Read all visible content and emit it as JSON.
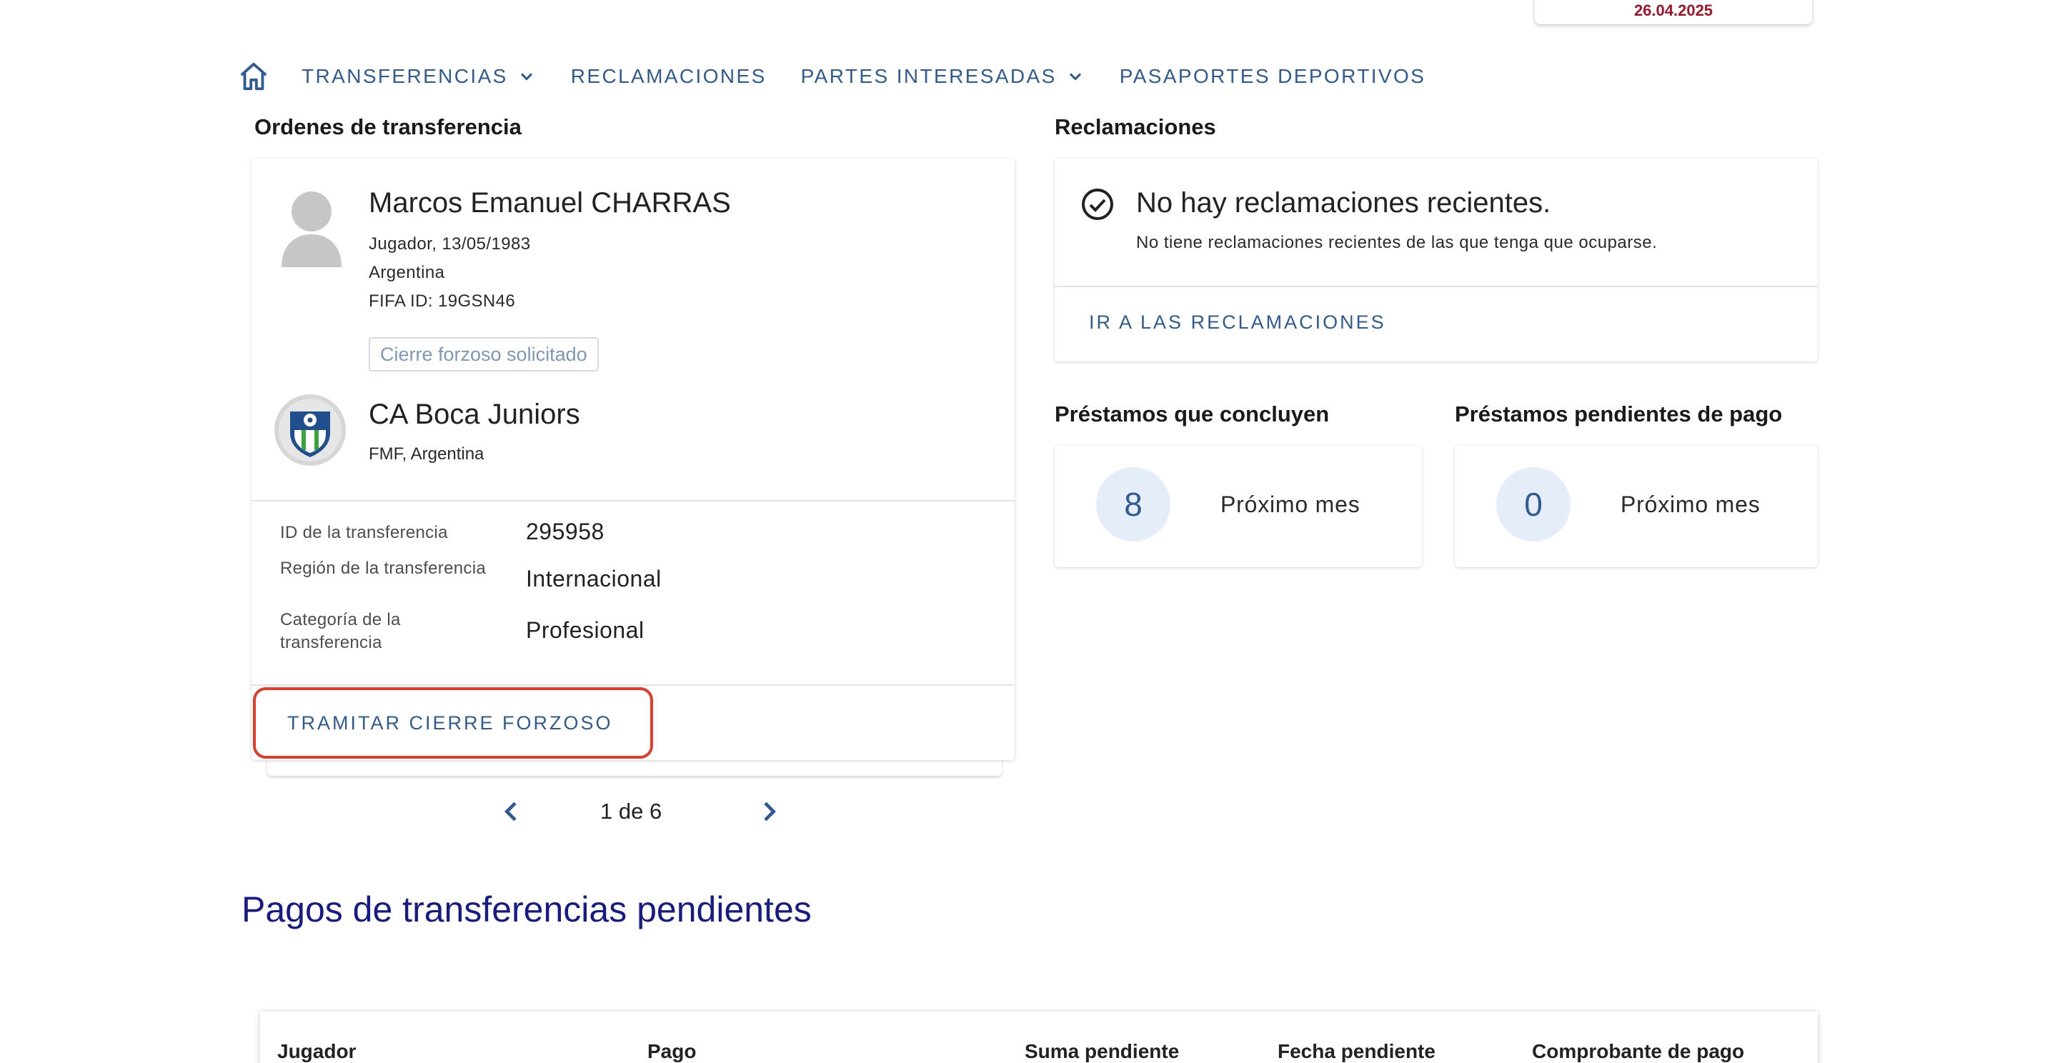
{
  "date_card": {
    "date": "26.04.2025"
  },
  "nav": {
    "items": [
      {
        "label": "TRANSFERENCIAS",
        "has_dropdown": true
      },
      {
        "label": "RECLAMACIONES",
        "has_dropdown": false
      },
      {
        "label": "PARTES INTERESADAS",
        "has_dropdown": true
      },
      {
        "label": "PASAPORTES DEPORTIVOS",
        "has_dropdown": false
      }
    ]
  },
  "transfers": {
    "section_title": "Ordenes de transferencia",
    "player": {
      "name": "Marcos Emanuel CHARRAS",
      "role_dob": "Jugador, 13/05/1983",
      "nationality": "Argentina",
      "fifa_id": "FIFA ID: 19GSN46",
      "status_badge": "Cierre forzoso solicitado"
    },
    "club": {
      "name": "CA Boca Juniors",
      "association": "FMF, Argentina"
    },
    "details": [
      {
        "label": "ID de la transferencia",
        "value": "295958"
      },
      {
        "label": "Región de la transferencia",
        "value": "Internacional"
      },
      {
        "label": "Categoría de la transferencia",
        "value": "Profesional"
      }
    ],
    "action_label": "TRAMITAR CIERRE FORZOSO",
    "pagination": {
      "text": "1 de 6",
      "current": 1,
      "total": 6
    }
  },
  "claims": {
    "section_title": "Reclamaciones",
    "title": "No hay reclamaciones recientes.",
    "subtitle": "No tiene reclamaciones recientes de las que tenga que ocuparse.",
    "link_label": "IR A LAS RECLAMACIONES"
  },
  "loans_ending": {
    "section_title": "Préstamos que concluyen",
    "count": "8",
    "period": "Próximo mes"
  },
  "loans_pending_payment": {
    "section_title": "Préstamos pendientes de pago",
    "count": "0",
    "period": "Próximo mes"
  },
  "pending_payments": {
    "title": "Pagos de transferencias pendientes",
    "columns": [
      "Jugador",
      "Pago",
      "Suma pendiente",
      "Fecha pendiente",
      "Comprobante de pago"
    ]
  },
  "colors": {
    "accent": "#2f5b94",
    "heading_blue": "#161b88",
    "highlight_red": "#e03b2b",
    "date_red": "#a0152a"
  }
}
